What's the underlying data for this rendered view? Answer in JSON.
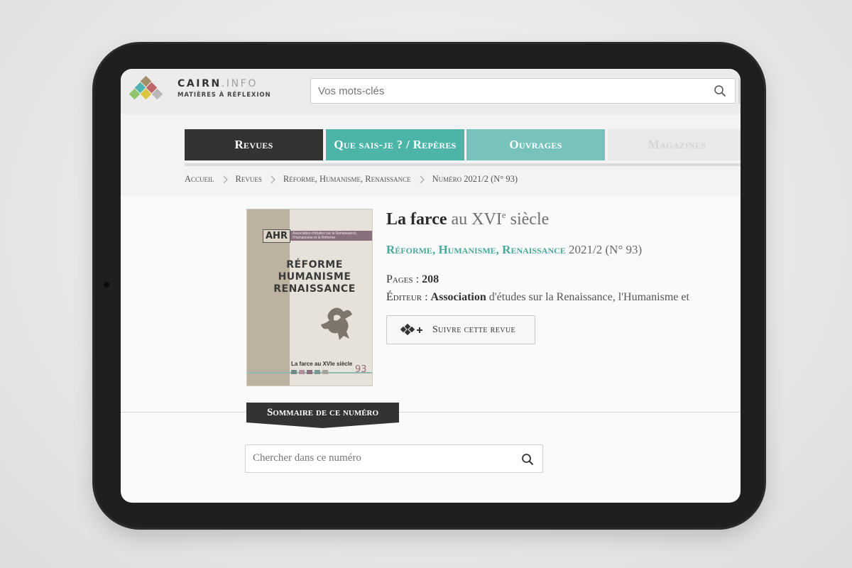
{
  "brand": {
    "name_main": "CAIRN",
    "name_dot": ".INFO",
    "tagline": "MATIÈRES À RÉFLEXION"
  },
  "header_search": {
    "placeholder": "Vos mots-clés"
  },
  "nav_tabs": [
    {
      "label": "Revues",
      "active": true,
      "color": "#333333"
    },
    {
      "label": "Que sais-je ? / Repères",
      "active": false,
      "color": "#4db4a8"
    },
    {
      "label": "Ouvrages",
      "active": false,
      "color": "#77c3bb"
    },
    {
      "label": "Magazines",
      "active": false,
      "color": "#e9e9e9"
    }
  ],
  "breadcrumb": [
    "Accueil",
    "Revues",
    "Réforme, Humanisme, Renaissance",
    "Numéro 2021/2 (N° 93)"
  ],
  "cover": {
    "logo": "AHR",
    "strip_text": "Association d'études sur la Renaissance, l'Humanisme et la Réforme",
    "title_lines": [
      "RÉFORME",
      "HUMANISME",
      "RENAISSANCE"
    ],
    "theme": "La farce au XVIe siècle",
    "number": "93",
    "image": "griffin-illustration"
  },
  "issue": {
    "title_main": "La farce",
    "title_rest": "au XVI",
    "title_sup": "e",
    "title_end": "siècle",
    "journal": "Réforme, Humanisme, Renaissance",
    "issue_label": "2021/2 (N° 93)",
    "pages_label": "Pages :",
    "pages_value": "208",
    "editor_label": "Éditeur :",
    "editor_bold": "Association",
    "editor_rest": "d'études sur la Renaissance, l'Humanisme et"
  },
  "follow_button": {
    "label": "Suivre cette revue",
    "icon": "diamonds-plus-icon"
  },
  "sommaire": {
    "label": "Sommaire de ce numéro"
  },
  "issue_search": {
    "placeholder": "Chercher dans ce numéro"
  },
  "colors": {
    "accent_teal": "#4db4a8",
    "light_teal": "#77c3bb",
    "dark": "#333333"
  }
}
